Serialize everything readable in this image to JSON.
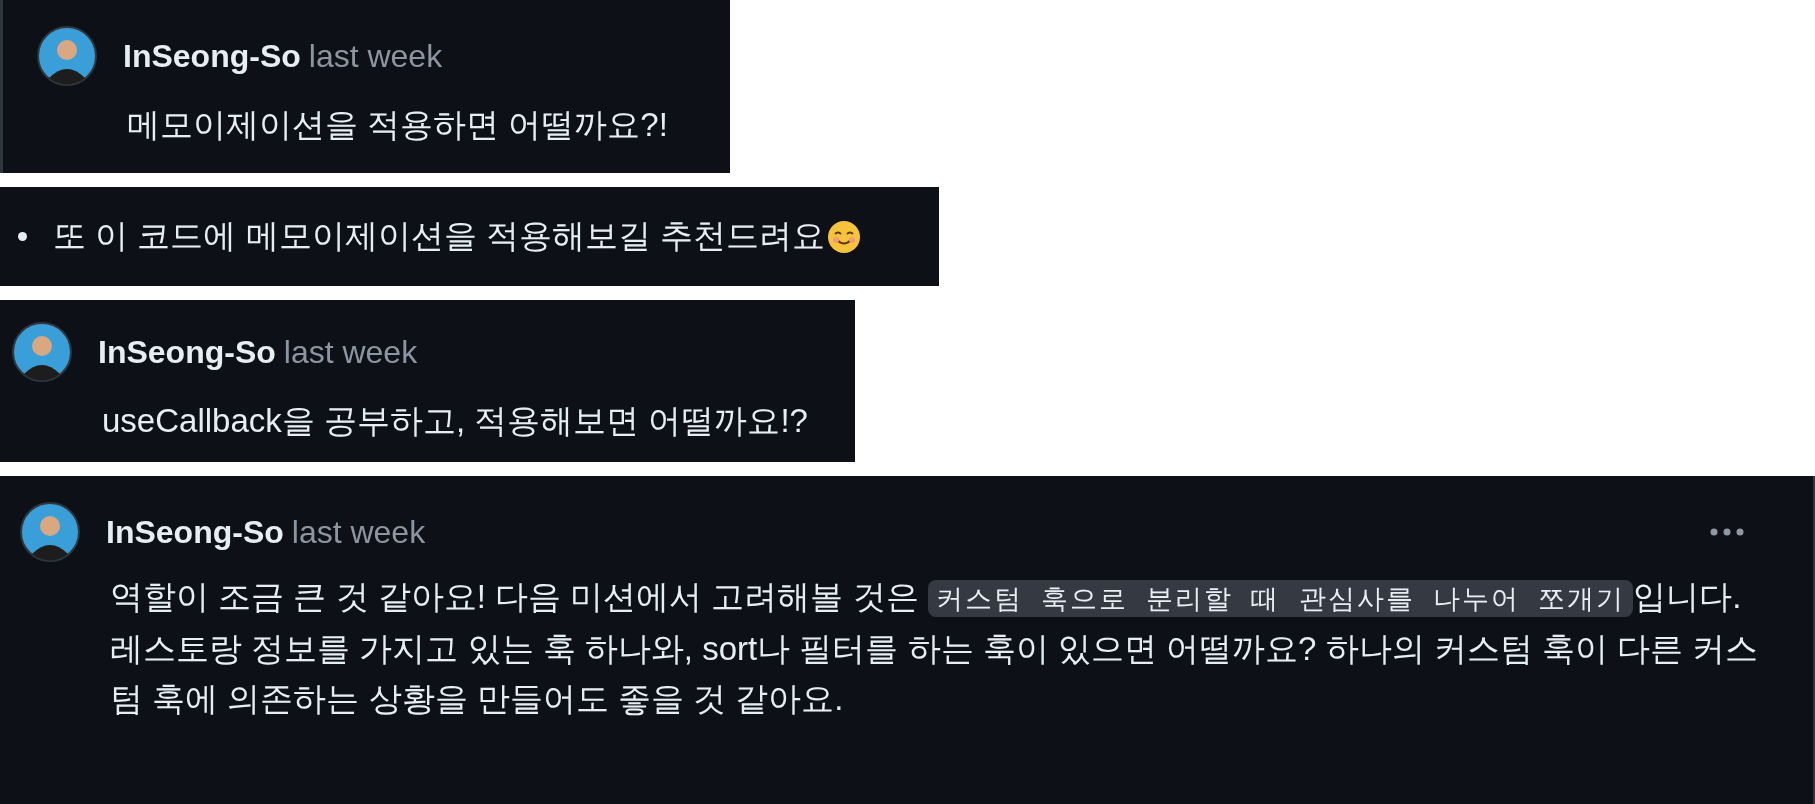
{
  "panels": [
    {
      "kind": "comment",
      "author": "InSeong-So",
      "time": "last week",
      "lines": [
        [
          {
            "kind": "text",
            "text": "메모이제이션을 적용하면 어떨까요?!"
          }
        ]
      ]
    },
    {
      "kind": "bullet",
      "text": "또 이 코드에 메모이제이션을 적용해보길 추천드려요"
    },
    {
      "kind": "comment",
      "author": "InSeong-So",
      "time": "last week",
      "lines": [
        [
          {
            "kind": "text",
            "text": "useCallback을 공부하고, 적용해보면 어떨까요!?"
          }
        ]
      ]
    },
    {
      "kind": "comment",
      "author": "InSeong-So",
      "time": "last week",
      "menu": true,
      "lines": [
        [
          {
            "kind": "text",
            "text": "역할이 조금 큰 것 같아요! 다음 미션에서 고려해볼 것은 "
          },
          {
            "kind": "code",
            "text": "커스텀 훅으로 분리할 때 관심사를 나누어 쪼개기"
          },
          {
            "kind": "text",
            "text": "입니다."
          }
        ],
        [
          {
            "kind": "text",
            "text": "레스토랑 정보를 가지고 있는 훅 하나와, sort나 필터를 하는 훅이 있으면 어떨까요? 하나의 커스텀 훅이 다른 커스텀 훅에 의존하는 상황을 만들어도 좋을 것 같아요."
          }
        ]
      ]
    }
  ]
}
